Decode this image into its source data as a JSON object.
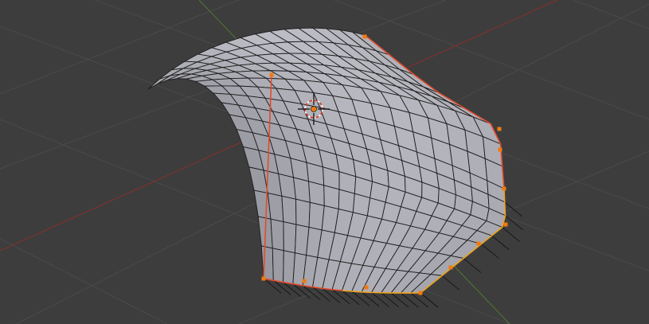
{
  "viewport": {
    "background": "#3d3d3d",
    "grid_color": "#4a4a4a",
    "axis_x_color": "#8a2e2e",
    "axis_y_color": "#4e7a2f"
  },
  "mesh": {
    "face_color": "#a9a9b1",
    "wire_color": "#1e1e1e",
    "selected_edge_color": "#e24b2b",
    "active_edge_color": "#f0a21a",
    "vertex_color": "#f07a10",
    "rows": 17,
    "cols": 17
  },
  "cursor_icon": "3d-cursor-icon",
  "pin_icon": "boundary-pin-icon"
}
